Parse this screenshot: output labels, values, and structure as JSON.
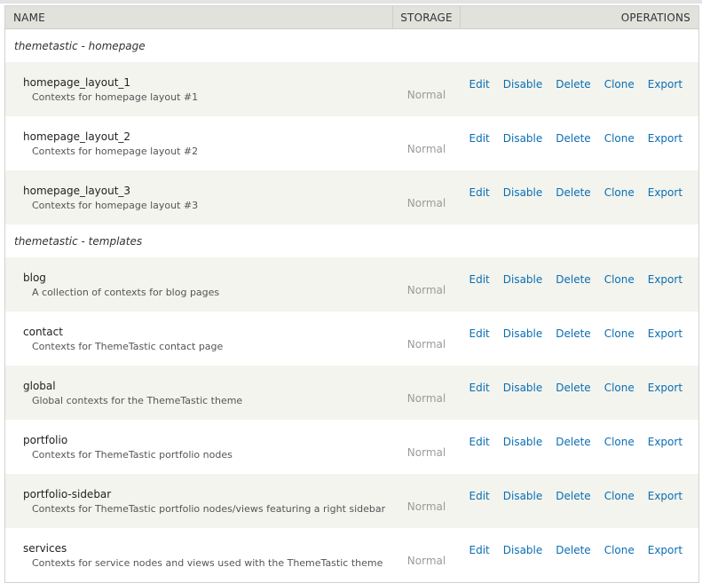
{
  "header": {
    "name": "NAME",
    "storage": "STORAGE",
    "operations": "OPERATIONS"
  },
  "groups": [
    {
      "title": "themetastic - homepage",
      "rows": [
        {
          "name": "homepage_layout_1",
          "description": "Contexts for homepage layout #1",
          "storage": "Normal"
        },
        {
          "name": "homepage_layout_2",
          "description": "Contexts for homepage layout #2",
          "storage": "Normal"
        },
        {
          "name": "homepage_layout_3",
          "description": "Contexts for homepage layout #3",
          "storage": "Normal"
        }
      ]
    },
    {
      "title": "themetastic - templates",
      "rows": [
        {
          "name": "blog",
          "description": "A collection of contexts for blog pages",
          "storage": "Normal"
        },
        {
          "name": "contact",
          "description": "Contexts for ThemeTastic contact page",
          "storage": "Normal"
        },
        {
          "name": "global",
          "description": "Global contexts for the ThemeTastic theme",
          "storage": "Normal"
        },
        {
          "name": "portfolio",
          "description": "Contexts for ThemeTastic portfolio nodes",
          "storage": "Normal"
        },
        {
          "name": "portfolio-sidebar",
          "description": "Contexts for ThemeTastic portfolio nodes/views featuring a right sidebar",
          "storage": "Normal"
        },
        {
          "name": "services",
          "description": "Contexts for service nodes and views used with the ThemeTastic theme",
          "storage": "Normal"
        }
      ]
    }
  ],
  "operations": [
    "Edit",
    "Disable",
    "Delete",
    "Clone",
    "Export"
  ],
  "colors": {
    "link": "#0a6eb4",
    "header_bg": "#e1e2dc",
    "row_alt_bg": "#f3f4ee"
  }
}
